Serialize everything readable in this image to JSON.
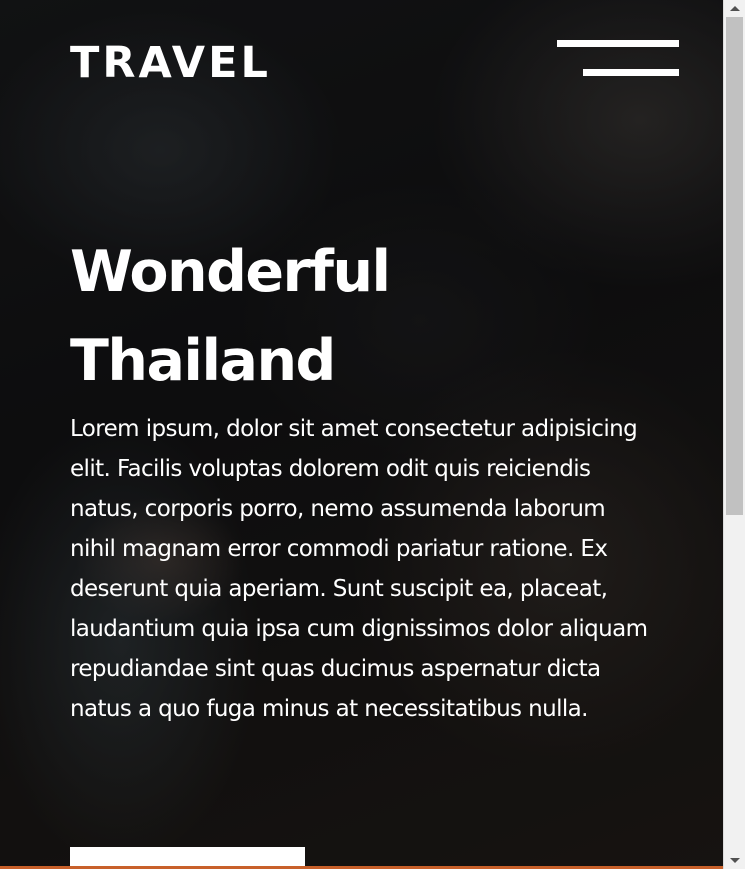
{
  "brand": {
    "logo_text": "TRAVEL"
  },
  "nav": {
    "menu_icon": "hamburger-menu-icon"
  },
  "hero": {
    "title_line1": "Wonderful",
    "title_line2": "Thailand",
    "description": "Lorem ipsum, dolor sit amet consectetur adipisicing elit. Facilis voluptas dolorem odit quis reiciendis natus, corporis porro, nemo assumenda laborum nihil magnam error commodi pariatur ratione. Ex deserunt quia aperiam. Sunt suscipit ea, placeat, laudantium quia ipsa cum dignissimos dolor aliquam repudiandae sint quas ducimus aspernatur dicta natus a quo fuga minus at necessitatibus nulla."
  },
  "colors": {
    "text": "#ffffff",
    "background": "#1a1919",
    "accent_line": "#c8602a",
    "scrollbar_track": "#f1f1f1",
    "scrollbar_thumb": "#c1c1c1"
  },
  "scrollbar": {
    "up_icon": "scroll-up-arrow-icon",
    "down_icon": "scroll-down-arrow-icon"
  }
}
